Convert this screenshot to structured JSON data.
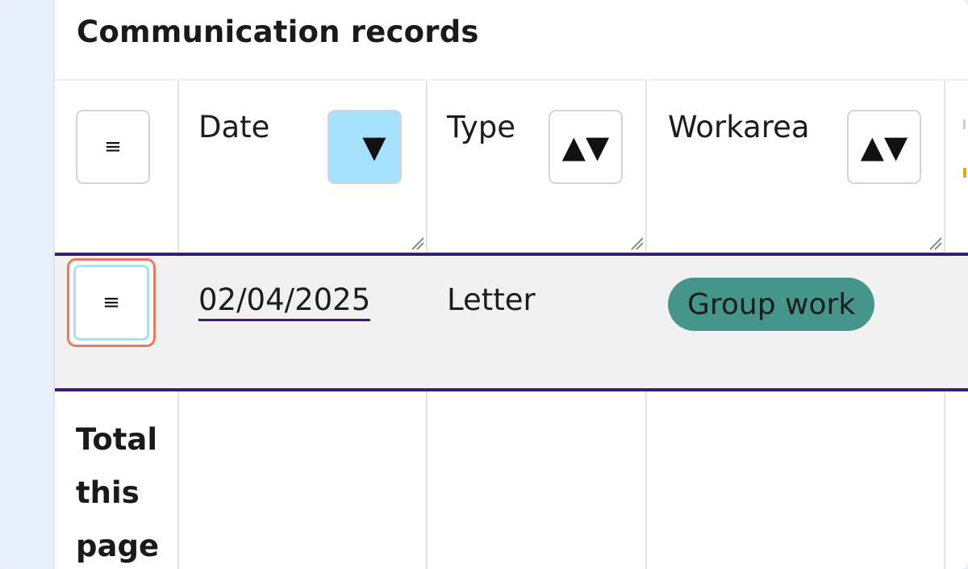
{
  "section": {
    "title": "Communication records"
  },
  "table": {
    "row_menu_icon": "≡",
    "columns": [
      {
        "label": "Date",
        "sort_glyph": "▼",
        "sort_state": "descending"
      },
      {
        "label": "Type",
        "sort_glyph": "▲▼",
        "sort_state": "unsorted"
      },
      {
        "label": "Workarea",
        "sort_glyph": "▲▼",
        "sort_state": "unsorted"
      }
    ],
    "rows": [
      {
        "date": "02/04/2025",
        "type": "Letter",
        "workarea": "Group work"
      }
    ],
    "footer": {
      "total_label": "Total this page"
    }
  },
  "colors": {
    "accent_purple": "#3d1a78",
    "sort_active": "#a6e1fb",
    "tag_teal": "#45958a",
    "focus_ring": "#f0775f",
    "row_bg": "#f1f1f1",
    "left_strip": "#e8f0fd"
  },
  "icons": {
    "row_menu": "hamburger-menu-icon",
    "sort_desc": "sort-descending-icon",
    "sort_both": "sort-unsorted-icon",
    "resize": "column-resize-handle-icon"
  }
}
